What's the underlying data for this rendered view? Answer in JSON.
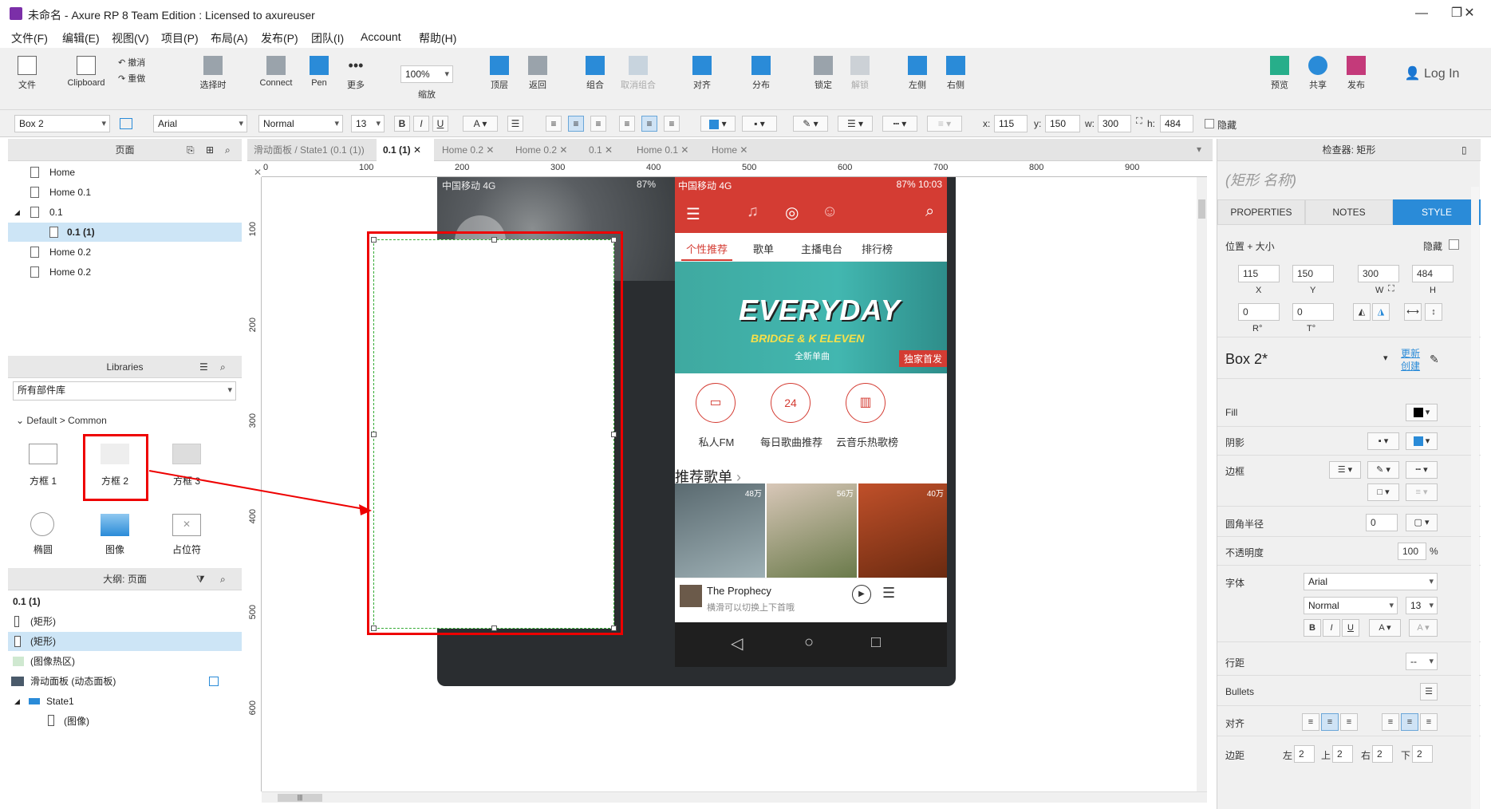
{
  "window": {
    "title": "未命名 - Axure RP 8 Team Edition : Licensed to axureuser",
    "controls": [
      "—",
      "❐",
      "✕"
    ]
  },
  "menu": [
    "文件(F)",
    "编辑(E)",
    "视图(V)",
    "项目(P)",
    "布局(A)",
    "发布(P)",
    "团队(I)",
    "Account",
    "帮助(H)"
  ],
  "toolbar": {
    "file_label": "文件",
    "clipboard_label": "Clipboard",
    "undo_label": "撤消",
    "redo_label": "重做",
    "select_label": "选择时",
    "connect_label": "Connect",
    "pen_label": "Pen",
    "more_label": "更多",
    "zoom_value": "100%",
    "zoom_label": "缩放",
    "top_label": "顶层",
    "back_label": "返回",
    "group_label": "组合",
    "ungroup_label": "取消组合",
    "align_label": "对齐",
    "distribute_label": "分布",
    "lock_label": "锁定",
    "unlock_label": "解锁",
    "left_label": "左侧",
    "right_label": "右侧",
    "preview_label": "预览",
    "share_label": "共享",
    "publish_label": "发布",
    "login_label": "Log In"
  },
  "formatbar": {
    "widget_name": "Box 2",
    "font": "Arial",
    "weight": "Normal",
    "size": "13",
    "bold": "B",
    "italic": "I",
    "underline": "U",
    "x_label": "x:",
    "x": "115",
    "y_label": "y:",
    "y": "150",
    "w_label": "w:",
    "w": "300",
    "h_label": "h:",
    "h": "484",
    "hidden_label": "隐藏"
  },
  "pages_panel": {
    "title": "页面",
    "items": [
      "Home",
      "Home 0.1",
      "0.1",
      "0.1 (1)",
      "Home 0.2",
      "Home 0.2"
    ]
  },
  "libraries_panel": {
    "title": "Libraries",
    "dropdown": "所有部件库",
    "group": "Default > Common",
    "widgets": [
      "方框 1",
      "方框 2",
      "方框 3",
      "椭圆",
      "图像",
      "占位符"
    ]
  },
  "outline_panel": {
    "title": "大纲: 页面",
    "page": "0.1 (1)",
    "items": [
      "(矩形)",
      "(矩形)",
      "(图像热区)",
      "滑动面板 (动态面板)",
      "State1",
      "(图像)"
    ]
  },
  "tabs": [
    "滑动面板 / State1 (0.1 (1))",
    "0.1 (1)",
    "Home 0.2",
    "Home 0.2",
    "0.1",
    "Home 0.1",
    "Home"
  ],
  "ruler": {
    "h": [
      "0",
      "100",
      "200",
      "300",
      "400",
      "500",
      "600",
      "700",
      "800",
      "900"
    ],
    "v": [
      "100",
      "200",
      "300",
      "400",
      "500",
      "600"
    ]
  },
  "phone": {
    "status_left": "中国移动 4G",
    "status_right": "87% 10:03",
    "status_left2": "中国移动 4G",
    "status_right2": "87%",
    "tabs": [
      "个性推荐",
      "歌单",
      "主播电台",
      "排行榜"
    ],
    "banner_title": "EVERYDAY",
    "banner_sub": "BRIDGE & K ELEVEN",
    "banner_sub2": "全新单曲",
    "banner_badge": "独家首发",
    "icons": [
      "私人FM",
      "每日歌曲推荐",
      "云音乐热歌榜"
    ],
    "calendar_day": "24",
    "rec_title": "推荐歌单",
    "covers": [
      "48万",
      "56万",
      "40万"
    ],
    "song": "The Prophecy",
    "song_sub": "横滑可以切换上下首哦"
  },
  "inspector": {
    "title": "检查器: 矩形",
    "name_placeholder": "(矩形 名称)",
    "tabs": [
      "PROPERTIES",
      "NOTES",
      "STYLE"
    ],
    "pos_label": "位置 + 大小",
    "hidden_label": "隐藏",
    "x": "115",
    "y": "150",
    "w": "300",
    "h": "484",
    "x_lbl": "X",
    "y_lbl": "Y",
    "w_lbl": "W",
    "h_lbl": "H",
    "r": "0",
    "t": "0",
    "r_lbl": "R°",
    "t_lbl": "T°",
    "style_name": "Box 2*",
    "update_label": "更新",
    "create_label": "创建",
    "fill_label": "Fill",
    "shadow_label": "阴影",
    "border_label": "边框",
    "radius_label": "圆角半径",
    "radius": "0",
    "opacity_label": "不透明度",
    "opacity": "100",
    "opacity_unit": "%",
    "font_label": "字体",
    "font": "Arial",
    "weight": "Normal",
    "size": "13",
    "line_label": "行距",
    "line_value": "--",
    "bullets_label": "Bullets",
    "align_label": "对齐",
    "padding_label": "边距",
    "pad_left_lbl": "左",
    "pad_left": "2",
    "pad_top_lbl": "上",
    "pad_top": "2",
    "pad_right_lbl": "右",
    "pad_right": "2",
    "pad_bottom_lbl": "下",
    "pad_bottom": "2"
  },
  "colors": {
    "accent": "#2a8bd8",
    "selection_red": "#ee0000",
    "music_red": "#d43c33"
  }
}
